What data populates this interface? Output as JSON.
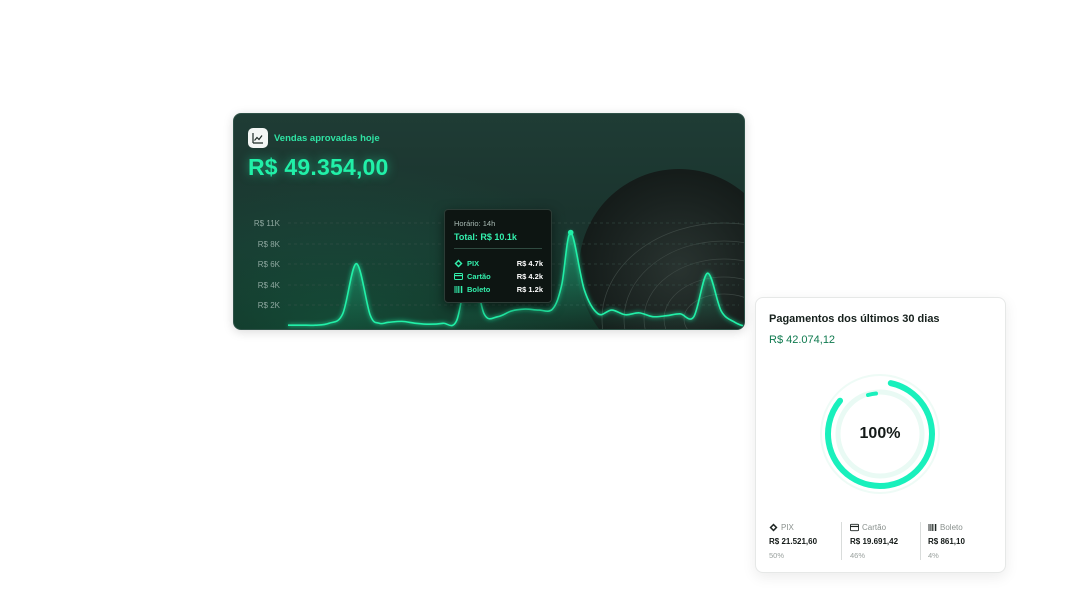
{
  "sales_card": {
    "title": "Vendas aprovadas hoje",
    "total": "R$ 49.354,00",
    "icon": "chart-icon",
    "y_ticks": [
      "R$ 11K",
      "R$ 8K",
      "R$ 6K",
      "R$ 4K",
      "R$ 2K"
    ],
    "tooltip": {
      "hour": "Horário: 14h",
      "total": "Total: R$ 10.1k",
      "rows": [
        {
          "label": "PIX",
          "value": "R$ 4.7k",
          "icon": "pix-icon"
        },
        {
          "label": "Cartão",
          "value": "R$ 4.2k",
          "icon": "card-icon"
        },
        {
          "label": "Boleto",
          "value": "R$ 1.2k",
          "icon": "barcode-icon"
        }
      ]
    },
    "chart_data": {
      "type": "area",
      "y_ticks": [
        "R$ 11K",
        "R$ 8K",
        "R$ 6K",
        "R$ 4K",
        "R$ 2K"
      ],
      "series": [
        {
          "x": [
            0,
            0.03,
            0.06,
            0.09,
            0.12,
            0.15,
            0.18,
            0.2,
            0.22,
            0.25,
            0.28,
            0.31,
            0.34,
            0.37,
            0.4,
            0.43,
            0.46,
            0.49,
            0.52,
            0.55,
            0.58,
            0.6,
            0.62,
            0.65,
            0.68,
            0.71,
            0.74,
            0.77,
            0.8,
            0.83,
            0.86,
            0.89,
            0.92,
            0.95,
            0.98,
            1.0
          ],
          "values": [
            0.3,
            0.3,
            0.3,
            0.5,
            1.5,
            6.8,
            1.4,
            0.5,
            0.6,
            0.7,
            0.5,
            0.4,
            0.5,
            0.8,
            6.9,
            1.5,
            1.2,
            1.8,
            2.0,
            1.9,
            2.0,
            4.5,
            10.1,
            4.0,
            1.5,
            1.9,
            1.4,
            1.6,
            1.2,
            1.3,
            1.5,
            1.2,
            5.8,
            1.8,
            0.6,
            0.2
          ]
        }
      ],
      "ylim": [
        0,
        11
      ]
    },
    "colors": {
      "accent": "#21f0a8",
      "background": "#1b342e"
    }
  },
  "payments_card": {
    "title": "Pagamentos dos últimos 30 dias",
    "total": "R$ 42.074,12",
    "donut_label": "100%",
    "methods": [
      {
        "label": "PIX",
        "amount": "R$ 21.521,60",
        "percent": "50%",
        "icon": "pix-icon"
      },
      {
        "label": "Cartão",
        "amount": "R$ 19.691,42",
        "percent": "46%",
        "icon": "card-icon"
      },
      {
        "label": "Boleto",
        "amount": "R$ 861,10",
        "percent": "4%",
        "icon": "barcode-icon"
      }
    ],
    "colors": {
      "ring": "#19f0bc",
      "ring_track": "#e9faf4"
    }
  }
}
